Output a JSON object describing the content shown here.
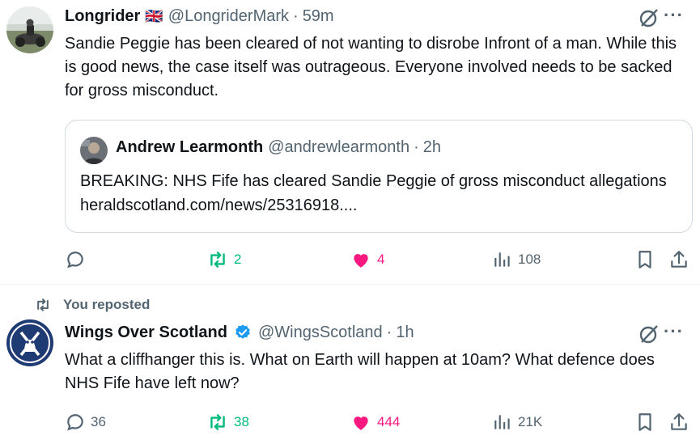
{
  "tweets": [
    {
      "author": {
        "name": "Longrider",
        "flag": "🇬🇧",
        "handle": "@LongriderMark",
        "time": "59m"
      },
      "text": "Sandie Peggie has been cleared of not wanting to disrobe Infront of a man. While this is good news, the case itself was outrageous. Everyone involved needs to be sacked for gross misconduct.",
      "quote": {
        "name": "Andrew Learmonth",
        "handle": "@andrewlearmonth",
        "time": "2h",
        "text": "BREAKING: NHS Fife has cleared Sandie Peggie of gross misconduct allegations heraldscotland.com/news/25316918...."
      },
      "stats": {
        "replies": "",
        "reposts": "2",
        "likes": "4",
        "views": "108"
      },
      "colors": {
        "repost": "#00ba7c",
        "like": "#f91880"
      }
    },
    {
      "context": "You reposted",
      "author": {
        "name": "Wings Over Scotland",
        "verified": true,
        "handle": "@WingsScotland",
        "time": "1h"
      },
      "text": "What a cliffhanger this is. What on Earth will happen at 10am? What defence does NHS Fife have left now?",
      "stats": {
        "replies": "36",
        "reposts": "38",
        "likes": "444",
        "views": "21K"
      },
      "colors": {
        "repost": "#00ba7c",
        "like": "#f91880",
        "verified": "#1d9bf0"
      }
    }
  ],
  "icons": [
    "reply-icon",
    "repost-icon",
    "heart-icon",
    "views-icon",
    "bookmark-icon",
    "share-icon",
    "grok-icon",
    "more-icon",
    "verified-icon"
  ]
}
